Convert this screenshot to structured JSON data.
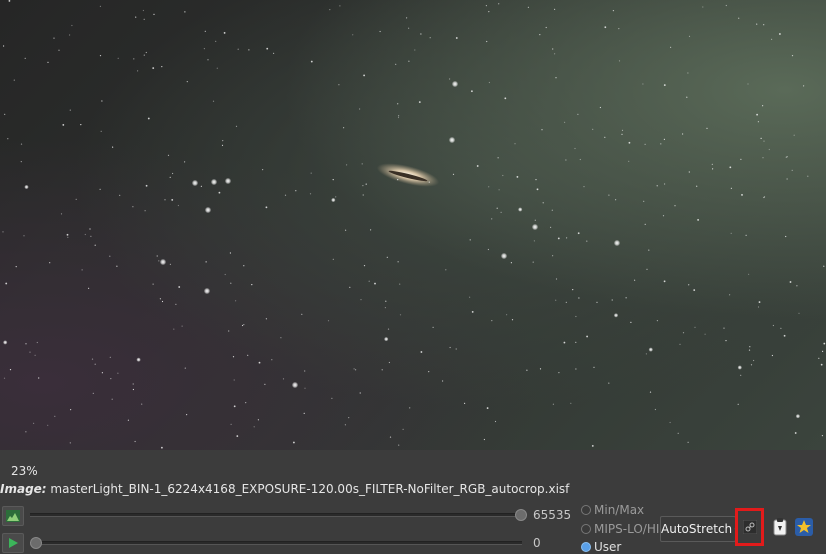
{
  "viewer": {
    "zoom_label": "23%",
    "image_label": "Image:",
    "filename": "masterLight_BIN-1_6224x4168_EXPOSURE-120.00s_FILTER-NoFilter_RGB_autocrop.xisf"
  },
  "stretch_panel": {
    "max_value": "65535",
    "min_value": "0",
    "radio_options": [
      {
        "label": "Min/Max",
        "selected": false
      },
      {
        "label": "MIPS-LO/HI",
        "selected": false
      },
      {
        "label": "User",
        "selected": true
      }
    ],
    "dropdown_value": "AutoStretch",
    "icons": {
      "histogram": "histogram-icon",
      "play": "play-icon",
      "link": "link-icon",
      "clipboard": "clipboard-icon",
      "star": "star-icon"
    },
    "highlight_color": "#e21b1b"
  }
}
